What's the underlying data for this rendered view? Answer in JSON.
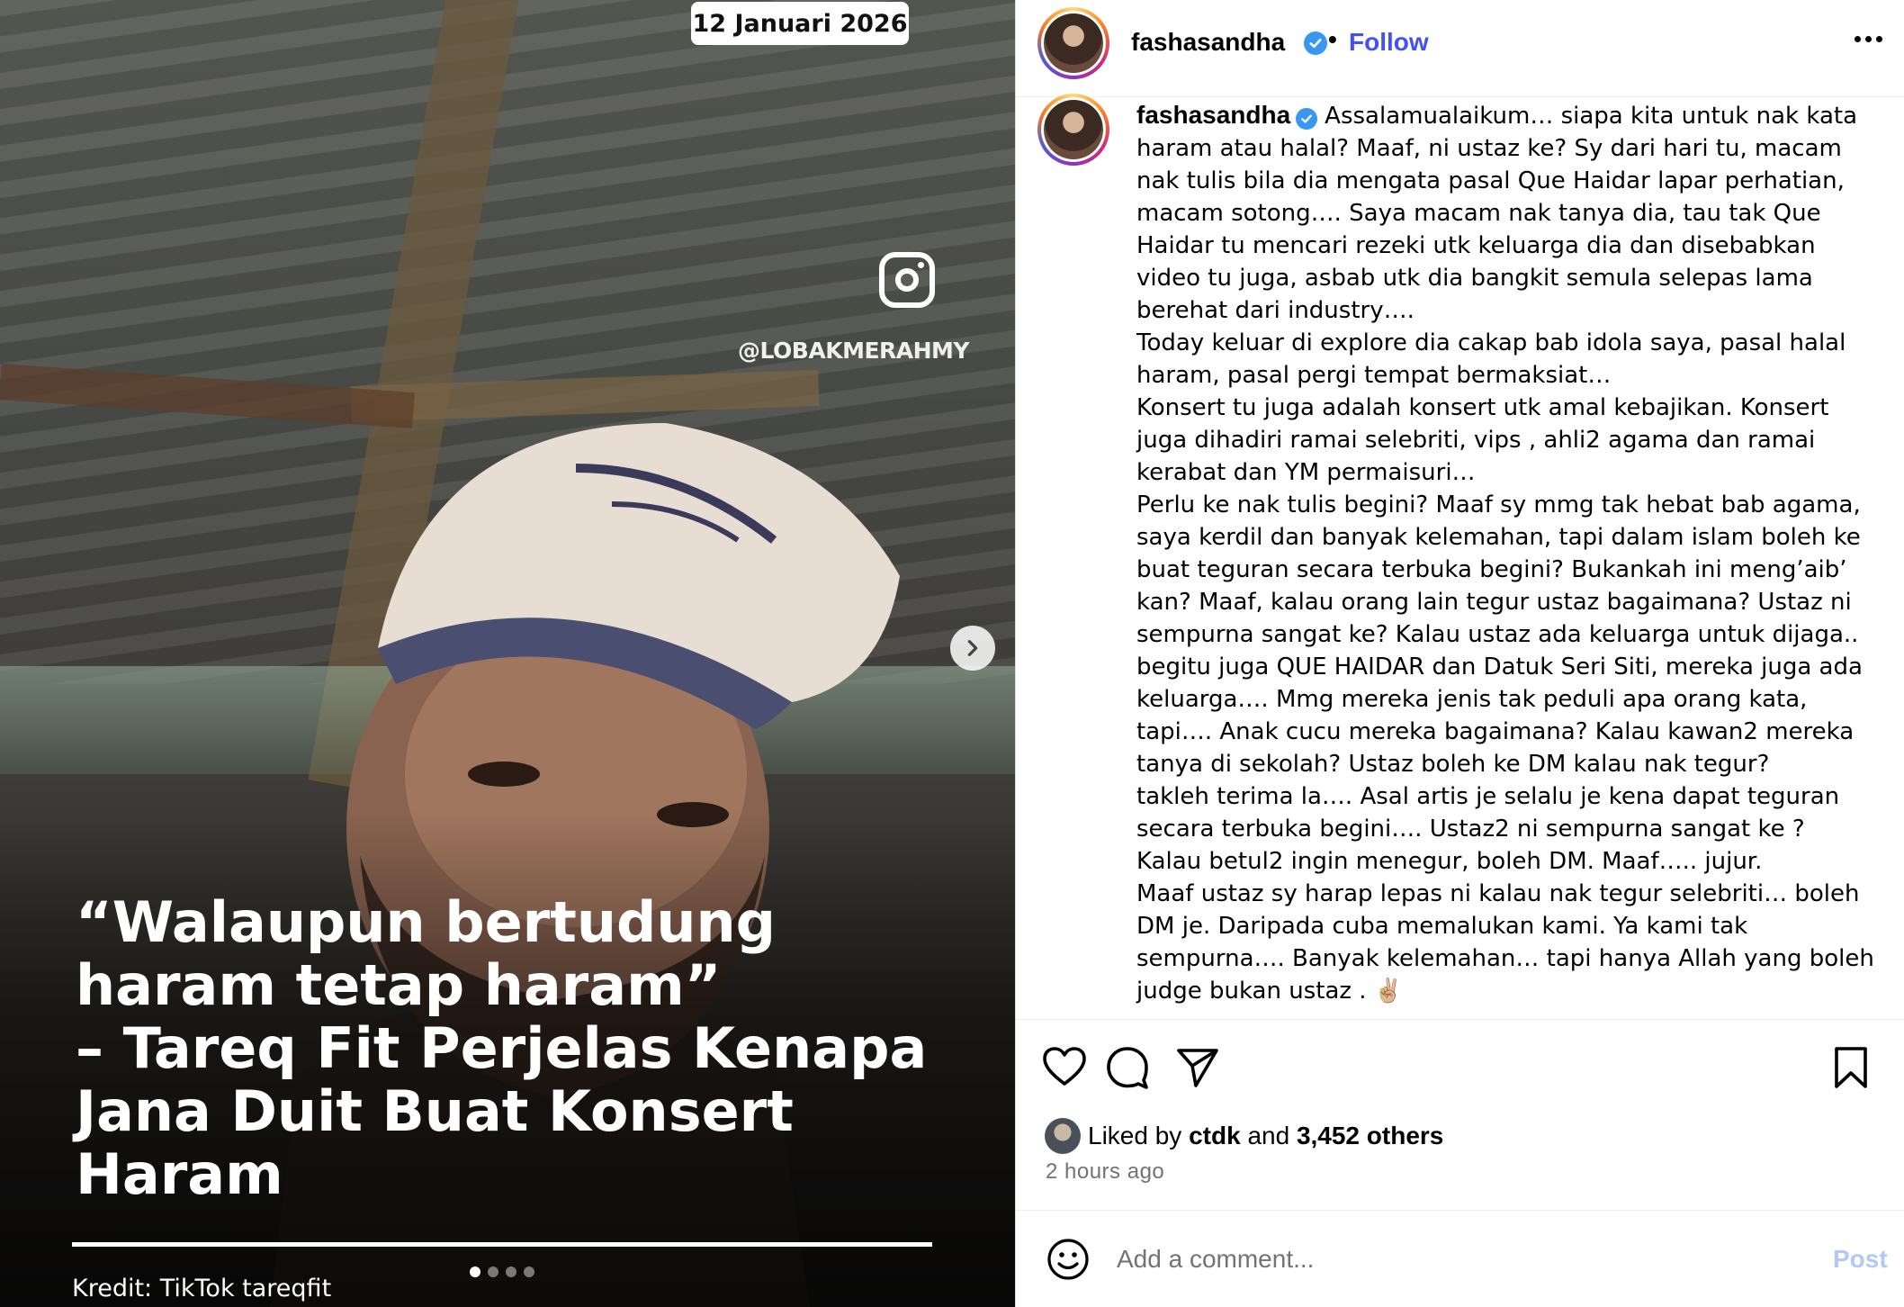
{
  "media": {
    "date_badge": "12 Januari 2026",
    "watermark_handle": "@LOBAKMERAHMY",
    "headline_lines": [
      "“Walaupun bertudung",
      "haram tetap haram”",
      "– Tareq Fit Perjelas Kenapa",
      "Jana Duit Buat Konsert",
      "Haram"
    ],
    "credit": "Kredit: TikTok tareqfit",
    "carousel_count": 4,
    "carousel_active": 1
  },
  "header": {
    "username": "fashasandha",
    "separator": "•",
    "follow_label": "Follow"
  },
  "caption": {
    "username": "fashasandha",
    "first_line": "Assalamualaikum… siapa kita untuk nak kata",
    "lines": [
      "haram atau halal? Maaf, ni ustaz ke? Sy dari hari tu, macam",
      "nak tulis bila dia mengata pasal Que Haidar lapar perhatian,",
      "macam sotong…. Saya macam nak tanya dia, tau tak Que",
      "Haidar tu mencari rezeki utk keluarga dia dan disebabkan",
      "video tu juga, asbab utk dia bangkit semula selepas lama",
      "berehat dari industry….",
      "Today keluar di explore dia cakap bab idola saya, pasal halal",
      "haram, pasal pergi tempat bermaksiat…",
      "Konsert tu juga adalah konsert utk amal kebajikan. Konsert",
      "juga dihadiri ramai selebriti, vips , ahli2 agama dan ramai",
      "kerabat dan YM permaisuri…",
      "Perlu ke nak tulis begini? Maaf sy mmg tak hebat bab agama,",
      "saya kerdil dan banyak kelemahan, tapi dalam islam boleh ke",
      "buat teguran secara terbuka begini? Bukankah ini meng’aib’",
      "kan? Maaf, kalau orang lain tegur ustaz bagaimana? Ustaz ni",
      "sempurna sangat ke? Kalau ustaz ada keluarga untuk dijaga..",
      "begitu juga QUE HAIDAR dan Datuk Seri Siti, mereka juga ada",
      "keluarga…. Mmg mereka jenis tak peduli apa orang kata,",
      "tapi…. Anak cucu mereka bagaimana? Kalau kawan2 mereka",
      "tanya di sekolah? Ustaz boleh ke DM kalau nak tegur?",
      "takleh terima la…. Asal artis je selalu je kena dapat teguran",
      "secara terbuka begini…. Ustaz2 ni sempurna sangat ke ?",
      "Kalau betul2 ingin menegur, boleh DM. Maaf….. jujur.",
      "Maaf ustaz sy harap lepas ni kalau nak tegur selebriti… boleh",
      "DM je. Daripada cuba memalukan kami. Ya kami tak",
      "sempurna…. Banyak kelemahan… tapi hanya Allah yang boleh",
      "judge bukan ustaz . ✌🏼"
    ]
  },
  "engagement": {
    "liked_prefix": "Liked by",
    "liked_user": "ctdk",
    "liked_and": "and",
    "liked_others": "3,452 others",
    "time_ago": "2 hours ago"
  },
  "comment": {
    "placeholder": "Add a comment...",
    "post_label": "Post"
  },
  "icons": {
    "like": "heart-icon",
    "comment": "comment-bubble-icon",
    "share": "paper-plane-icon",
    "save": "bookmark-icon",
    "emoji": "smiley-icon",
    "more": "more-options-icon",
    "next": "chevron-right-icon"
  },
  "colors": {
    "follow": "#4150f7",
    "verified": "#3897f0",
    "post_disabled": "#b2c8f5",
    "muted": "#737373"
  }
}
